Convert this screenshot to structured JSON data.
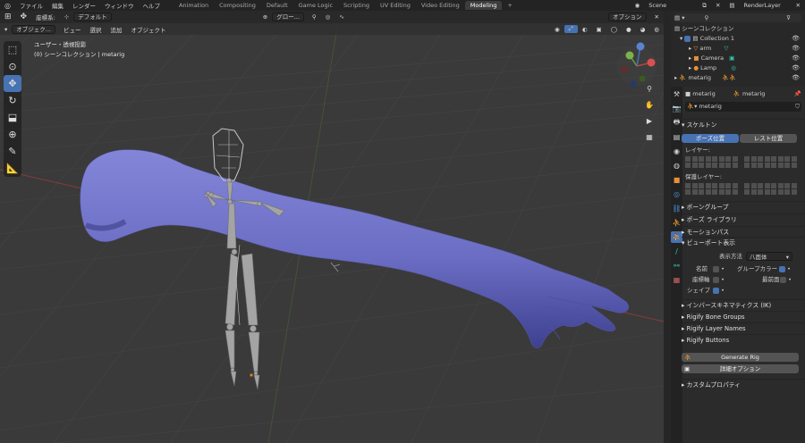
{
  "topbar": {
    "menus": [
      "ファイル",
      "編集",
      "レンダー",
      "ウィンドウ",
      "ヘルプ"
    ],
    "workspaces": [
      "Animation",
      "Compositing",
      "Default",
      "Game Logic",
      "Scripting",
      "UV Editing",
      "Video Editing",
      "Modeling",
      "+"
    ],
    "active_workspace": "Modeling",
    "scene": "Scene",
    "render_layer": "RenderLayer"
  },
  "viewport_header": {
    "coord_label": "座標系:",
    "pivot": "デフォルト",
    "orientation": "グロー...",
    "options": "オプション"
  },
  "viewport_header2": {
    "mode": "オブジェク...",
    "menus": [
      "ビュー",
      "選択",
      "追加",
      "オブジェクト"
    ]
  },
  "viewport": {
    "view_name": "ユーザー・透視投影",
    "collection_info": "(0) シーンコレクション | metarig"
  },
  "outliner": {
    "root": "シーンコレクション",
    "items": [
      {
        "name": "Collection 1"
      },
      {
        "name": "arm"
      },
      {
        "name": "Camera"
      },
      {
        "name": "Lamp"
      },
      {
        "name": "metarig"
      }
    ]
  },
  "properties": {
    "object_name": "metarig",
    "data_name": "metarig",
    "armature_field": "metarig",
    "panels": {
      "skeleton": "スケルトン",
      "pose_position": "ポーズ位置",
      "rest_position": "レスト位置",
      "layers": "レイヤー:",
      "protected_layers": "保護レイヤー:",
      "bone_groups": "ボーングループ",
      "pose_library": "ポーズ ライブラリ",
      "motion_paths": "モーションパス",
      "viewport_display": "ビューポート表示",
      "display_as_label": "表示方法",
      "display_as_value": "八面体",
      "names": "名前",
      "group_colors": "グループカラー",
      "axes": "座標軸",
      "in_front": "最前面",
      "shapes": "シェイプ",
      "ik": "インバースキネマティクス (IK)",
      "rigify_bone_groups": "Rigify Bone Groups",
      "rigify_layer_names": "Rigify Layer Names",
      "rigify_buttons": "Rigify Buttons",
      "generate_rig": "Generate Rig",
      "advanced_options": "詳細オプション",
      "custom_props": "カスタムプロパティ"
    },
    "checkbox_states": {
      "names": false,
      "group_colors": true,
      "axes": false,
      "in_front": false,
      "shapes": true
    }
  },
  "colors": {
    "accent": "#4772b3",
    "mesh": "#6c6fc4",
    "viewport_bg": "#3a3a3a",
    "bone": "#9a9a9a"
  }
}
